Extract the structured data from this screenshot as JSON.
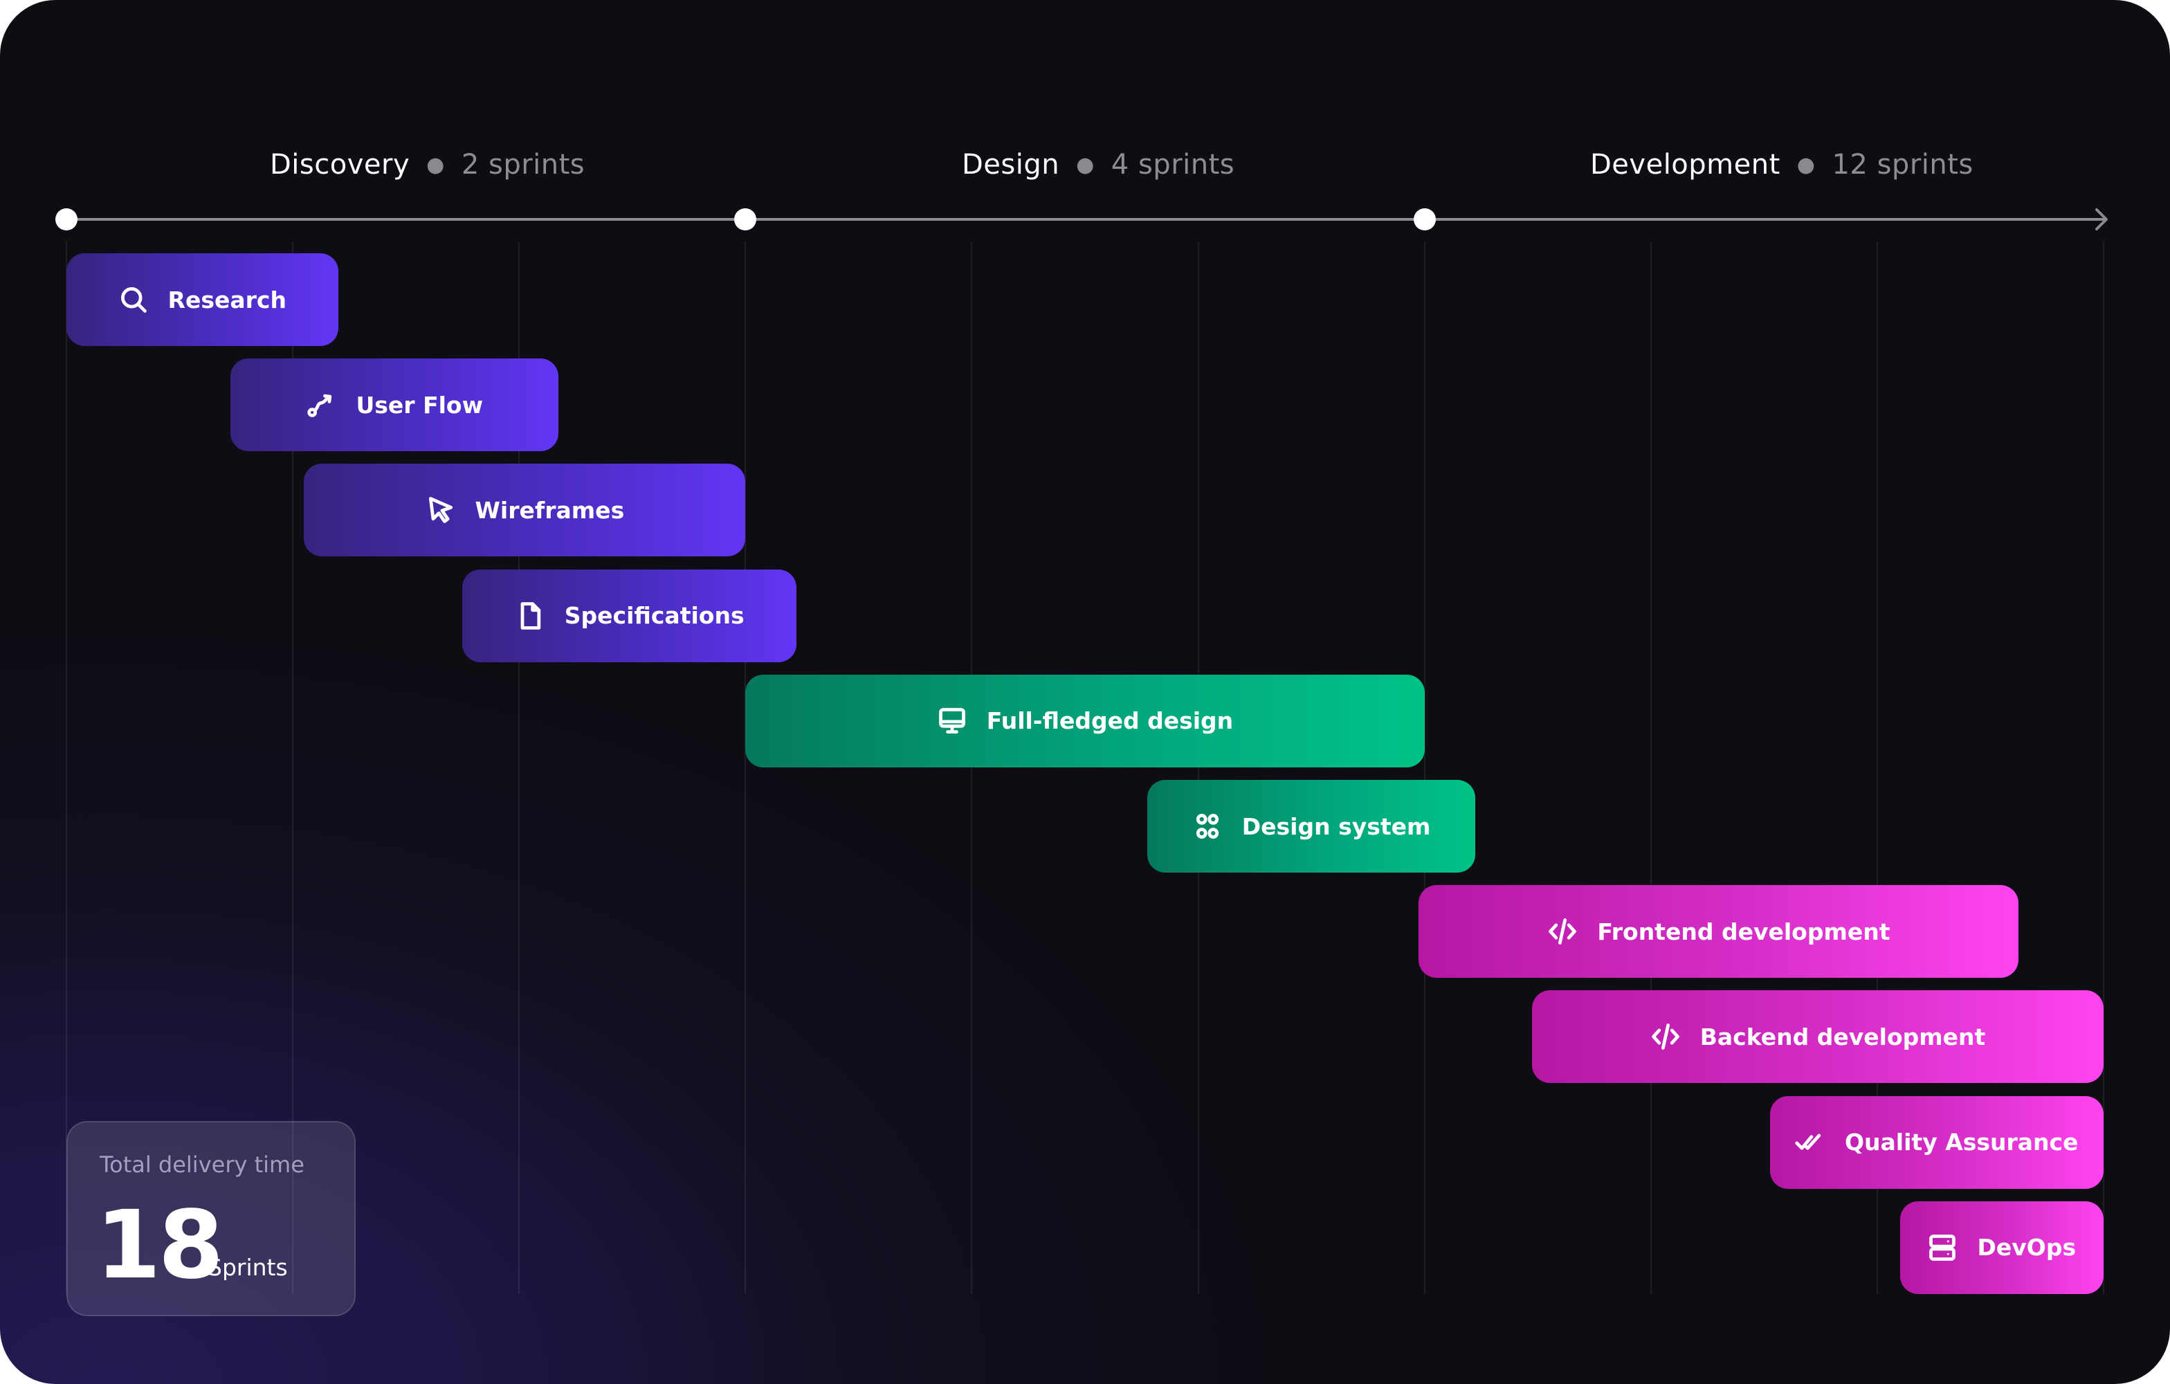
{
  "chart_data": {
    "type": "gantt",
    "title": "",
    "x_unit": "sprints",
    "x_range": [
      0,
      18
    ],
    "grid": true,
    "grid_step": 2,
    "phases": [
      {
        "name": "Discovery",
        "sprints_label": "2 sprints",
        "start": 0,
        "end": 6
      },
      {
        "name": "Design",
        "sprints_label": "4 sprints",
        "start": 6,
        "end": 12
      },
      {
        "name": "Development",
        "sprints_label": "12 sprints",
        "start": 12,
        "end": 18
      }
    ],
    "milestones": [
      0,
      6,
      12
    ],
    "tasks": [
      {
        "label": "Research",
        "icon": "search-icon",
        "phase": "discovery",
        "start": 0,
        "end": 2.4
      },
      {
        "label": "User Flow",
        "icon": "route-icon",
        "phase": "discovery",
        "start": 1.45,
        "end": 4.35
      },
      {
        "label": "Wireframes",
        "icon": "cursor-icon",
        "phase": "discovery",
        "start": 2.1,
        "end": 6.0
      },
      {
        "label": "Specifications",
        "icon": "file-icon",
        "phase": "discovery",
        "start": 3.5,
        "end": 6.45
      },
      {
        "label": "Full-fledged design",
        "icon": "monitor-icon",
        "phase": "design",
        "start": 6.0,
        "end": 12.0
      },
      {
        "label": "Design system",
        "icon": "components-icon",
        "phase": "design",
        "start": 9.55,
        "end": 12.45
      },
      {
        "label": "Frontend development",
        "icon": "code-icon",
        "phase": "development",
        "start": 11.95,
        "end": 17.25
      },
      {
        "label": "Backend development",
        "icon": "code-icon",
        "phase": "development",
        "start": 12.95,
        "end": 18.0
      },
      {
        "label": "Quality Assurance",
        "icon": "double-check-icon",
        "phase": "development",
        "start": 15.05,
        "end": 18.0
      },
      {
        "label": "DevOps",
        "icon": "server-icon",
        "phase": "development",
        "start": 16.2,
        "end": 18.0
      }
    ]
  },
  "summary": {
    "label": "Total delivery time",
    "value": "18",
    "unit": "Sprints"
  },
  "colors": {
    "discovery": "#6236f4",
    "design": "#00c287",
    "development": "#ff44ef",
    "background": "#0e0d14",
    "axis": "#8b8a90"
  }
}
